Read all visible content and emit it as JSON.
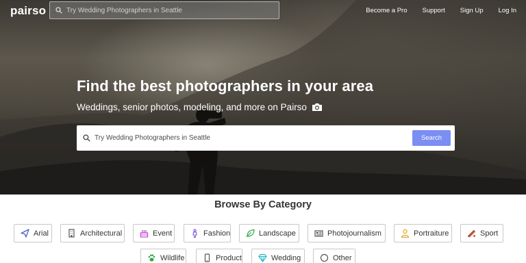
{
  "brand": {
    "logo_text": "pairso"
  },
  "header": {
    "search_placeholder": "Try Wedding Photographers in Seattle",
    "nav": [
      "Become a Pro",
      "Support",
      "Sign Up",
      "Log In"
    ]
  },
  "hero": {
    "headline": "Find the best photographers in your area",
    "subheadline": "Weddings, senior photos, modeling, and more on Pairso",
    "search_placeholder": "Try Wedding Photographers in Seattle",
    "search_button": "Search"
  },
  "categories": {
    "title": "Browse By Category",
    "items": [
      {
        "label": "Arial",
        "icon": "paper-plane-icon",
        "color": "#4a5fc8"
      },
      {
        "label": "Architectural",
        "icon": "building-icon",
        "color": "#555555"
      },
      {
        "label": "Event",
        "icon": "cake-icon",
        "color": "#b845c8"
      },
      {
        "label": "Fashion",
        "icon": "person-icon",
        "color": "#7a55d8"
      },
      {
        "label": "Landscape",
        "icon": "leaf-icon",
        "color": "#2fa84a"
      },
      {
        "label": "Photojournalism",
        "icon": "newspaper-icon",
        "color": "#555555"
      },
      {
        "label": "Portraiture",
        "icon": "user-icon",
        "color": "#e2a31b"
      },
      {
        "label": "Sport",
        "icon": "bat-icon",
        "color": "#b04a2a"
      },
      {
        "label": "Wildlife",
        "icon": "paw-icon",
        "color": "#2fa84a"
      },
      {
        "label": "Product",
        "icon": "mobile-icon",
        "color": "#555555"
      },
      {
        "label": "Wedding",
        "icon": "diamond-icon",
        "color": "#25b7c8"
      },
      {
        "label": "Other",
        "icon": "circle-icon",
        "color": "#555555"
      }
    ]
  }
}
